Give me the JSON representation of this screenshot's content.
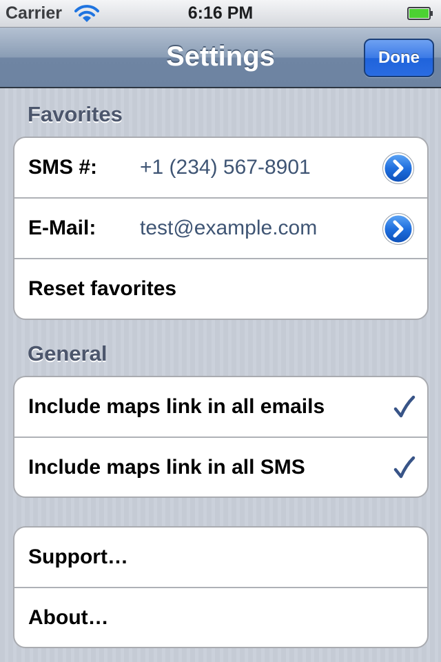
{
  "status_bar": {
    "carrier": "Carrier",
    "time": "6:16 PM",
    "wifi_icon": "wifi-icon",
    "battery_icon": "battery-icon",
    "battery_level": 1.0,
    "battery_color": "#4cd232"
  },
  "nav_bar": {
    "title": "Settings",
    "done_label": "Done",
    "done_color": "#2a6ce2"
  },
  "favorites": {
    "header": "Favorites",
    "sms": {
      "label": "SMS #:",
      "value": "+1 (234) 567-8901",
      "accessory": "disclosure-button-icon"
    },
    "email": {
      "label": "E-Mail:",
      "value": "test@example.com",
      "accessory": "disclosure-button-icon"
    },
    "reset": {
      "label": "Reset favorites"
    }
  },
  "general": {
    "header": "General",
    "maps_email": {
      "label": "Include maps link in all emails",
      "checked": true,
      "accessory": "checkmark-icon"
    },
    "maps_sms": {
      "label": "Include maps link in all SMS",
      "checked": true,
      "accessory": "checkmark-icon"
    }
  },
  "misc": {
    "support": {
      "label": "Support…"
    },
    "about": {
      "label": "About…"
    }
  }
}
